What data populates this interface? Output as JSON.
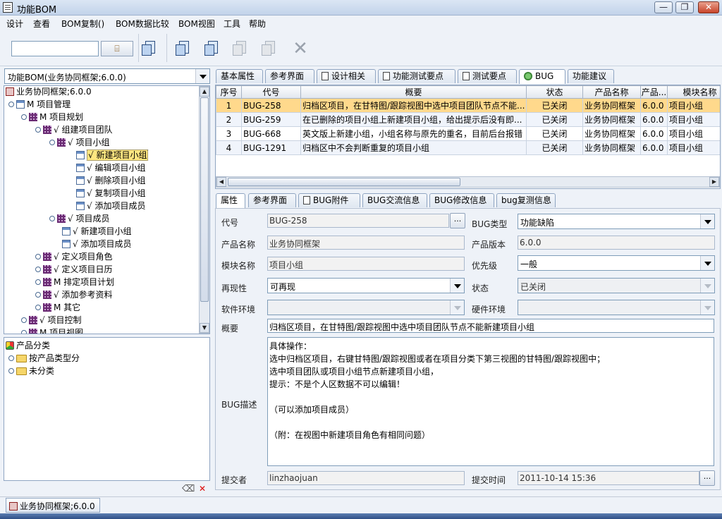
{
  "window": {
    "title": "功能BOM"
  },
  "menubar": [
    "设计",
    "查看",
    "BOM复制()",
    "BOM数据比较",
    "BOM视图",
    "工具",
    "帮助"
  ],
  "left": {
    "bom_selector": "功能BOM(业务协同框架;6.0.0)",
    "tree": [
      {
        "label": "业务协同框架;6.0.0",
        "prefix": ""
      },
      {
        "label": "项目管理",
        "prefix": "M "
      },
      {
        "label": "项目规划",
        "prefix": "M "
      },
      {
        "label": "组建项目团队",
        "prefix": "√ "
      },
      {
        "label": "项目小组",
        "prefix": "√ "
      },
      {
        "label": "新建项目小组",
        "prefix": "√ "
      },
      {
        "label": "编辑项目小组",
        "prefix": "√ "
      },
      {
        "label": "删除项目小组",
        "prefix": "√ "
      },
      {
        "label": "复制项目小组",
        "prefix": "√ "
      },
      {
        "label": "添加项目成员",
        "prefix": "√ "
      },
      {
        "label": "项目成员",
        "prefix": "√ "
      },
      {
        "label": "新建项目小组",
        "prefix": "√ "
      },
      {
        "label": "添加项目成员",
        "prefix": "√ "
      },
      {
        "label": "定义项目角色",
        "prefix": "√ "
      },
      {
        "label": "定义项目日历",
        "prefix": "√ "
      },
      {
        "label": "排定项目计划",
        "prefix": "M "
      },
      {
        "label": "添加参考资料",
        "prefix": "√ "
      },
      {
        "label": "其它",
        "prefix": "M "
      },
      {
        "label": "项目控制",
        "prefix": "√ "
      },
      {
        "label": "项目视图",
        "prefix": "M "
      }
    ],
    "category_tree": [
      "产品分类",
      "按产品类型分",
      "未分类"
    ]
  },
  "top_tabs": [
    "基本属性",
    "参考界面",
    "设计相关",
    "功能测试要点",
    "测试要点",
    "BUG",
    "功能建议"
  ],
  "bug_table": {
    "columns": [
      "序号",
      "代号",
      "概要",
      "状态",
      "产品名称",
      "产品...",
      "模块名称"
    ],
    "rows": [
      [
        "1",
        "BUG-258",
        "归档区项目，在甘特图/跟踪视图中选中项目团队节点不能...",
        "已关闭",
        "业务协同框架",
        "6.0.0",
        "项目小组"
      ],
      [
        "2",
        "BUG-259",
        "在已删除的项目小组上新建项目小组，给出提示后没有即...",
        "已关闭",
        "业务协同框架",
        "6.0.0",
        "项目小组"
      ],
      [
        "3",
        "BUG-668",
        "英文版上新建小组，小组名称与原先的重名，目前后台报错",
        "已关闭",
        "业务协同框架",
        "6.0.0",
        "项目小组"
      ],
      [
        "4",
        "BUG-1291",
        "归档区中不会判断重复的项目小组",
        "已关闭",
        "业务协同框架",
        "6.0.0",
        "项目小组"
      ]
    ]
  },
  "detail_tabs": [
    "属性",
    "参考界面",
    "BUG附件",
    "BUG交流信息",
    "BUG修改信息",
    "bug复测信息"
  ],
  "form": {
    "code_label": "代号",
    "code": "BUG-258",
    "bugtype_label": "BUG类型",
    "bugtype": "功能缺陷",
    "product_label": "产品名称",
    "product": "业务协同框架",
    "version_label": "产品版本",
    "version": "6.0.0",
    "module_label": "模块名称",
    "module": "项目小组",
    "priority_label": "优先级",
    "priority": "一般",
    "repro_label": "再现性",
    "repro": "可再现",
    "status_label": "状态",
    "status": "已关闭",
    "softenv_label": "软件环境",
    "softenv": "",
    "hardenv_label": "硬件环境",
    "hardenv": "",
    "summary_label": "概要",
    "summary": "归档区项目，在甘特图/跟踪视图中选中项目团队节点不能新建项目小组",
    "desc_label": "BUG描述",
    "desc": "具体操作：\n选中归档区项目，右键甘特图/跟踪视图或者在项目分类下第三视图的甘特图/跟踪视图中；\n选中项目团队或项目小组节点新建项目小组，\n提示：不是个人区数据不可以编辑！\n\n（可以添加项目成员）\n\n（附：在视图中新建项目角色有相同问题）",
    "submitter_label": "提交者",
    "submitter": "linzhaojuan",
    "submit_time_label": "提交时间",
    "submit_time": "2011-10-14 15:36"
  },
  "statusbar": {
    "tab": "业务协同框架;6.0.0"
  },
  "colors": {
    "selected_row": "#ffd98c",
    "selected_tree": "#ffe680",
    "title_gradient": "#c2d3ea"
  }
}
